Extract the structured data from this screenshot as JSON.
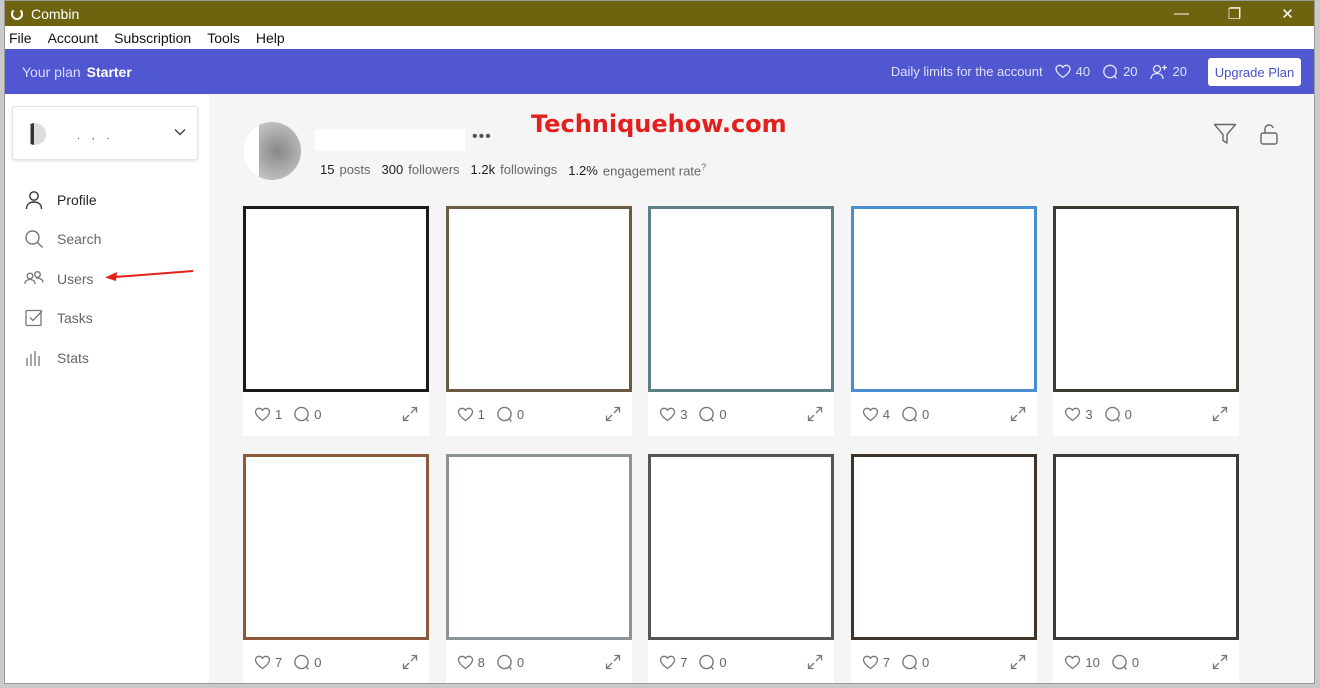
{
  "window": {
    "title": "Combin",
    "minimize": "—",
    "restore": "❐",
    "close": "✕"
  },
  "menu": [
    "File",
    "Account",
    "Subscription",
    "Tools",
    "Help"
  ],
  "plan": {
    "label": "Your plan",
    "name": "Starter",
    "limits_label": "Daily limits for the account",
    "likes": "40",
    "comments": "20",
    "follows": "20",
    "upgrade_label": "Upgrade Plan"
  },
  "sidebar": {
    "nav": [
      {
        "label": "Profile",
        "icon": "user-icon"
      },
      {
        "label": "Search",
        "icon": "search-icon"
      },
      {
        "label": "Users",
        "icon": "users-icon"
      },
      {
        "label": "Tasks",
        "icon": "tasks-icon"
      },
      {
        "label": "Stats",
        "icon": "stats-icon"
      }
    ]
  },
  "watermark": "Techniquehow.com",
  "profile": {
    "posts": "15",
    "posts_label": "posts",
    "followers": "300",
    "followers_label": "followers",
    "followings": "1.2k",
    "followings_label": "followings",
    "engagement": "1.2%",
    "engagement_label": "engagement rate",
    "more": "•••"
  },
  "posts": [
    {
      "likes": "1",
      "comments": "0"
    },
    {
      "likes": "1",
      "comments": "0"
    },
    {
      "likes": "3",
      "comments": "0"
    },
    {
      "likes": "4",
      "comments": "0"
    },
    {
      "likes": "3",
      "comments": "0"
    },
    {
      "likes": "7",
      "comments": "0"
    },
    {
      "likes": "8",
      "comments": "0"
    },
    {
      "likes": "7",
      "comments": "0"
    },
    {
      "likes": "7",
      "comments": "0"
    },
    {
      "likes": "10",
      "comments": "0"
    }
  ],
  "colors": {
    "titlebar": "#6e6410",
    "planbar": "#5156d1",
    "accent": "#4a50cc",
    "watermark": "#e2201e"
  }
}
